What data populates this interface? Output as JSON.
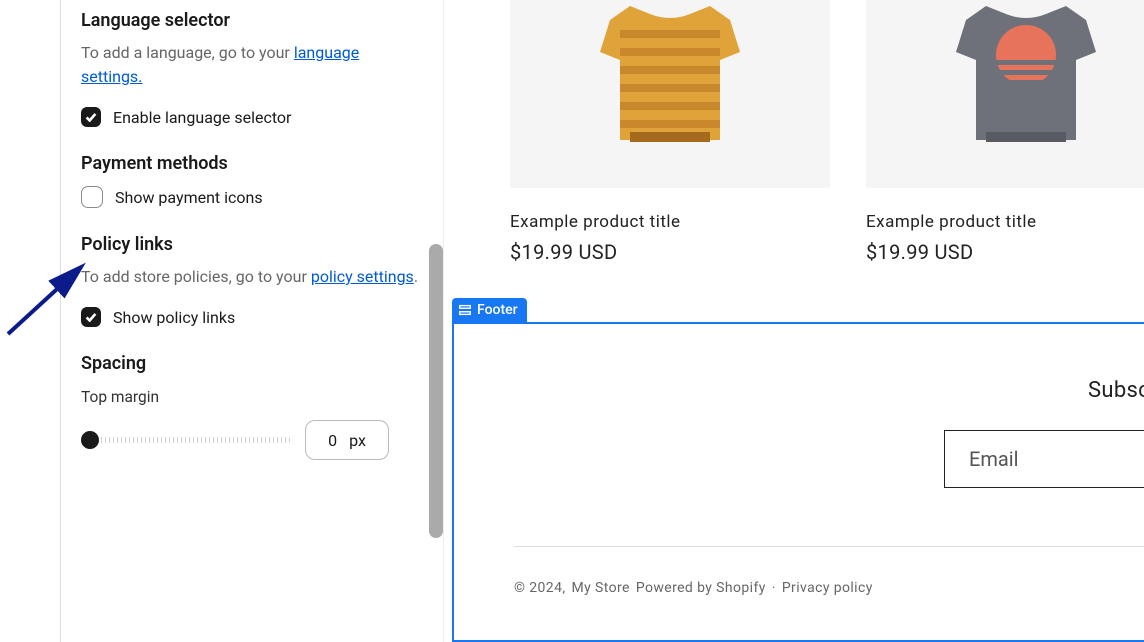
{
  "sidebar": {
    "language": {
      "heading": "Language selector",
      "help_prefix": "To add a language, go to your ",
      "help_link": "language settings.",
      "checkbox_label": "Enable language selector",
      "checked": true
    },
    "payment": {
      "heading": "Payment methods",
      "checkbox_label": "Show payment icons",
      "checked": false
    },
    "policy": {
      "heading": "Policy links",
      "help_prefix": "To add store policies, go to your ",
      "help_link": "policy settings",
      "help_after": ".",
      "checkbox_label": "Show policy links",
      "checked": true
    },
    "spacing": {
      "heading": "Spacing",
      "top_margin_label": "Top margin",
      "value": "0",
      "unit": "px"
    }
  },
  "preview": {
    "products": [
      {
        "title": "Example product title",
        "price": "$19.99 USD"
      },
      {
        "title": "Example product title",
        "price": "$19.99 USD"
      }
    ],
    "footer_tag": "Footer",
    "subscribe_heading": "Subscribe",
    "email_placeholder": "Email",
    "legal_prefix": "© 2024, ",
    "legal_store": "My Store",
    "legal_powered": " Powered by Shopify",
    "legal_dot": "·",
    "legal_privacy": "Privacy policy"
  }
}
